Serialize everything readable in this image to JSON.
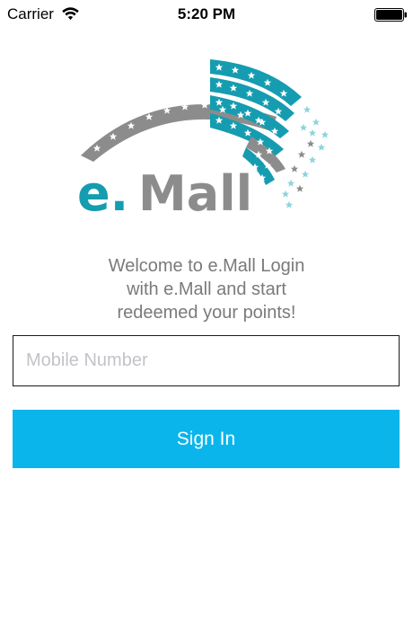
{
  "status_bar": {
    "carrier": "Carrier",
    "time": "5:20 PM",
    "wifi_icon": "wifi-icon",
    "battery_icon": "battery-icon"
  },
  "logo": {
    "text_e": "e.",
    "text_mall": "Mall",
    "colors": {
      "teal": "#169cb0",
      "gray": "#8c8c8c",
      "light_teal": "#8fd4dc"
    }
  },
  "welcome": {
    "line1": "Welcome to e.Mall Login",
    "line2": "with e.Mall and start",
    "line3": "redeemed your points!"
  },
  "login": {
    "mobile_placeholder": "Mobile Number",
    "mobile_value": "",
    "signin_label": "Sign In",
    "accent_color": "#0ab5ec"
  }
}
